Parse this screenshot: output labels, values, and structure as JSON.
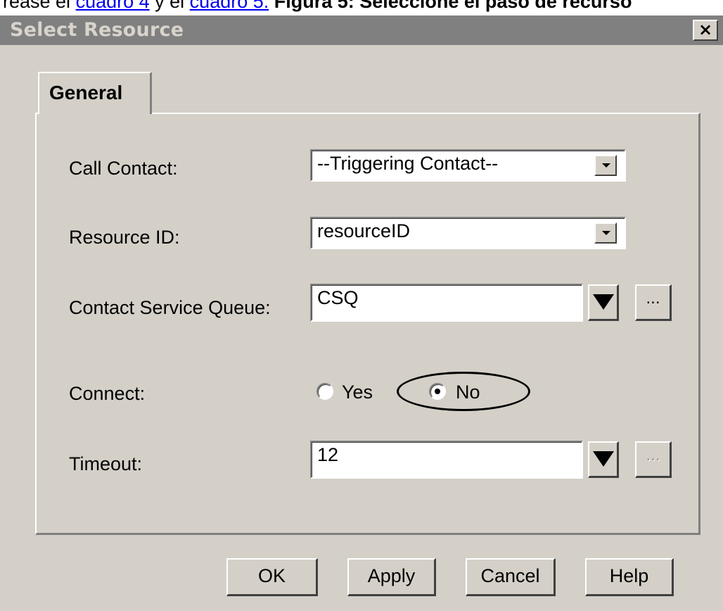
{
  "page_text": {
    "prefix": "rease el ",
    "link1": "cuadro 4",
    "middle": " y el ",
    "link2": "cuadro 5.",
    "bold": " Figura 5: Seleccione el paso de recurso"
  },
  "window": {
    "title": "Select Resource",
    "close_label": "×"
  },
  "tabs": [
    {
      "label": "General",
      "selected": true
    }
  ],
  "fields": {
    "call_contact": {
      "label": "Call Contact:",
      "value": "--Triggering Contact--"
    },
    "resource_id": {
      "label": "Resource ID:",
      "value": "resourceID"
    },
    "csq": {
      "label": "Contact Service Queue:",
      "value": "CSQ",
      "ellipsis": "..."
    },
    "connect": {
      "label": "Connect:",
      "yes": "Yes",
      "no": "No",
      "selected": "No"
    },
    "timeout": {
      "label": "Timeout:",
      "value": "12",
      "ellipsis": "..."
    }
  },
  "buttons": {
    "ok": "OK",
    "apply": "Apply",
    "cancel": "Cancel",
    "help": "Help"
  },
  "colors": {
    "dialog_bg": "#d4d0c8",
    "titlebar_bg": "#808080",
    "link": "#0000ee"
  }
}
